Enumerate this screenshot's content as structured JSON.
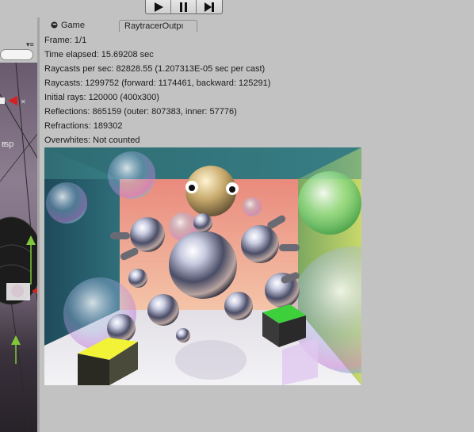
{
  "toolbar": {
    "play_icon": "play-icon",
    "pause_icon": "pause-icon",
    "step_icon": "step-icon"
  },
  "scene": {
    "persp_label": "rsp"
  },
  "tabs": [
    {
      "label": "Game",
      "icon": "game-controller-icon"
    },
    {
      "label": "RaytracerOutpı"
    }
  ],
  "stats": {
    "frame": "Frame: 1/1",
    "time_elapsed": "Time elapsed: 15.69208 sec",
    "raycasts_per_sec": "Raycasts per sec: 82828.55 (1.207313E-05 sec per cast)",
    "raycasts": "Raycasts: 1299752 (forward: 1174461, backward: 125291)",
    "initial_rays": "Initial rays: 120000 (400x300)",
    "reflections": "Reflections: 865159 (outer: 807383, inner: 57776)",
    "refractions": "Refractions: 189302",
    "overwhites": "Overwhites: Not counted"
  },
  "render": {
    "resolution": "400x300"
  }
}
